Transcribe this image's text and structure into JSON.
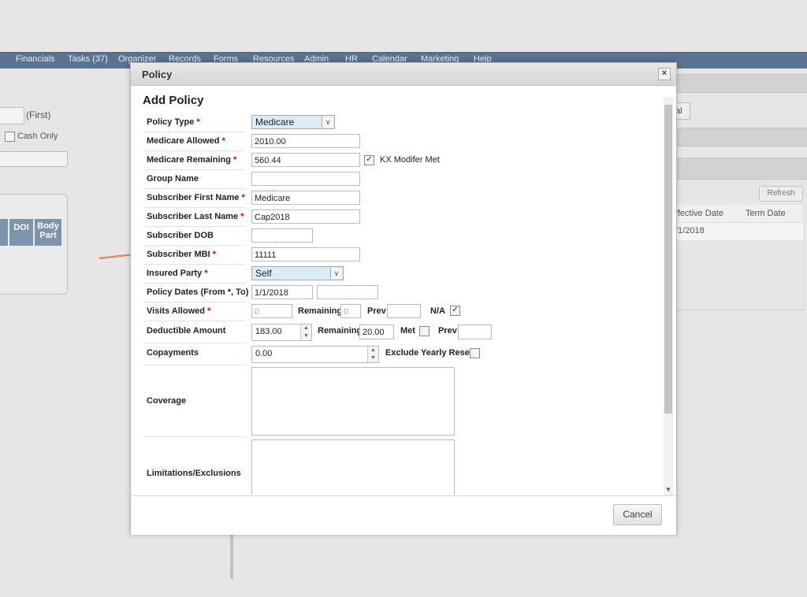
{
  "nav": [
    "Financials",
    "Tasks (37)",
    "Organizer",
    "Records",
    "Forms",
    "Resources",
    "Admin",
    "HR",
    "Calendar",
    "Marketing",
    "Help"
  ],
  "background": {
    "first_label": "(First)",
    "cash_only_label": "Cash Only",
    "col_doi": "DOI",
    "col_body_part": "Body Part",
    "right_btn_fragment": "al",
    "refresh_label": "Refresh",
    "col_effective_date": "ffective Date",
    "col_term_date": "Term Date",
    "row_date": "/1/2018"
  },
  "dialog": {
    "title": "Policy",
    "close": "×",
    "form_title": "Add Policy",
    "required_mark": "*",
    "labels": {
      "policy_type": "Policy Type",
      "medicare_allowed": "Medicare Allowed",
      "medicare_remaining": "Medicare Remaining",
      "group_name": "Group Name",
      "subscriber_first_name": "Subscriber First Name",
      "subscriber_last_name": "Subscriber Last Name",
      "subscriber_dob": "Subscriber DOB",
      "subscriber_mbi": "Subscriber MBI",
      "insured_party": "Insured Party",
      "policy_dates": "Policy Dates (From *, To)",
      "visits_allowed": "Visits Allowed",
      "deductible_amount": "Deductible Amount",
      "copayments": "Copayments",
      "coverage": "Coverage",
      "limitations": "Limitations/Exclusions"
    },
    "values": {
      "policy_type": "Medicare",
      "medicare_allowed": "2010.00",
      "medicare_remaining": "560.44",
      "group_name": "",
      "subscriber_first_name": "Medicare",
      "subscriber_last_name": "Cap2018",
      "subscriber_dob": "",
      "subscriber_mbi": "11111",
      "insured_party": "Self",
      "policy_from": "1/1/2018",
      "policy_to": "",
      "visits_allowed": "0",
      "visits_remaining": "0",
      "visits_prev": "",
      "deductible_amount": "183.00",
      "deductible_remaining": "20.00",
      "deductible_prev": "",
      "copayments": "0.00"
    },
    "inline": {
      "kx_modifier": "KX Modifer Met",
      "remaining": "Remaining",
      "prev": "Prev",
      "na": "N/A",
      "met": "Met",
      "exclude_yearly_reset": "Exclude Yearly Reset"
    },
    "checkmark": "✓",
    "cancel_label": "Cancel"
  }
}
